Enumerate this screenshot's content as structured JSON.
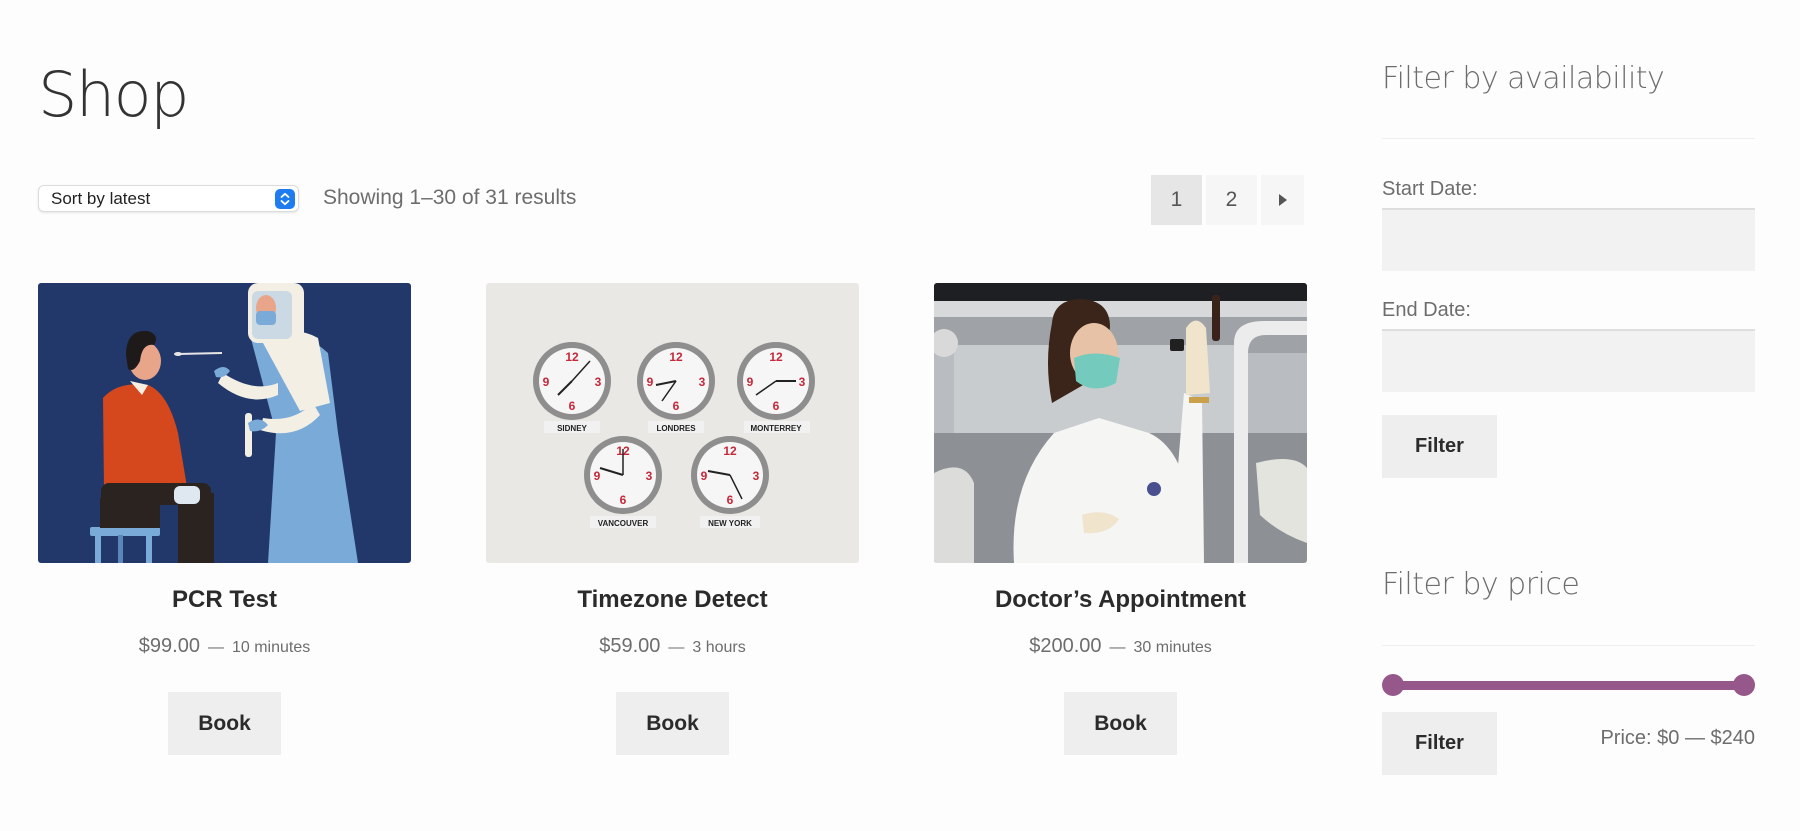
{
  "page": {
    "title": "Shop"
  },
  "toolbar": {
    "sort_value": "Sort by latest",
    "result_count": "Showing 1–30 of 31 results"
  },
  "pagination": {
    "pages": [
      "1",
      "2"
    ],
    "current_page": "1",
    "next_icon": "triangle-right-icon"
  },
  "products": [
    {
      "title": "PCR Test",
      "price": "$99.00",
      "separator": "—",
      "duration": "10 minutes",
      "button_label": "Book",
      "image": "illustration of a health worker in protective gear taking a nasal swab from a seated man"
    },
    {
      "title": "Timezone Detect",
      "price": "$59.00",
      "separator": "—",
      "duration": "3 hours",
      "button_label": "Book",
      "image": "five wall clocks labelled by city",
      "clock_labels": [
        "SIDNEY",
        "LONDRES",
        "MONTERREY",
        "VANCOUVER",
        "NEW YORK"
      ]
    },
    {
      "title": "Doctor’s Appointment",
      "price": "$200.00",
      "separator": "—",
      "duration": "30 minutes",
      "button_label": "Book",
      "image": "photo of a doctor in a white coat and mask holding up a sample vial"
    }
  ],
  "sidebar": {
    "availability": {
      "title": "Filter by availability",
      "start_label": "Start Date:",
      "start_value": "",
      "end_label": "End Date:",
      "end_value": "",
      "button_label": "Filter"
    },
    "price": {
      "title": "Filter by price",
      "range_min": 0,
      "range_max": 240,
      "selected_min": 0,
      "selected_max": 240,
      "button_label": "Filter",
      "label": "Price: $0 — $240"
    }
  },
  "colors": {
    "accent": "#96588a",
    "stepper_blue": "#1f7cf0",
    "button_bg": "#eeeeee",
    "input_bg": "#f2f2f2",
    "text_muted": "#6d6d6d"
  }
}
